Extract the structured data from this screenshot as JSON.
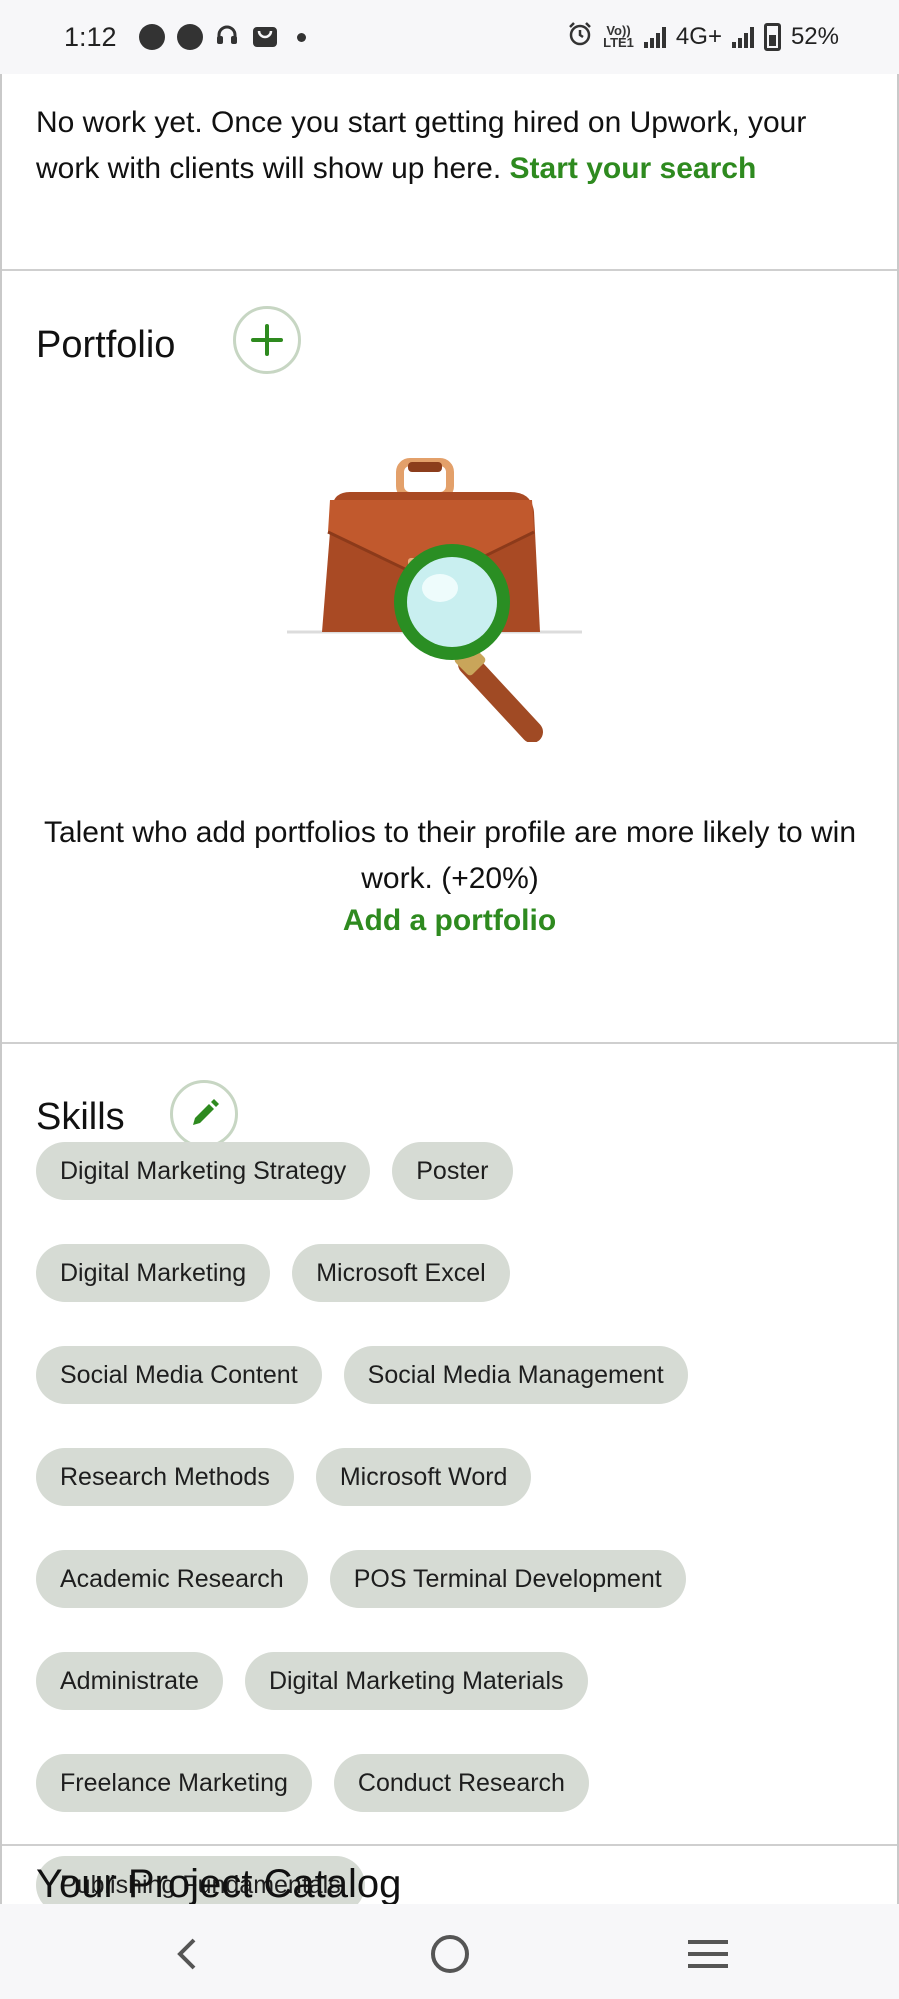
{
  "status_bar": {
    "time": "1:12",
    "left_icons": [
      "messenger-icon",
      "speedometer-icon",
      "headphones-icon",
      "shopping-bag-icon",
      "dot-icon"
    ],
    "volte_label_top": "Vo))",
    "volte_label_bottom": "LTE1",
    "network": "4G+",
    "battery": "52%"
  },
  "work": {
    "text": "No work yet. Once you start getting hired on Upwork, your work with clients will show up here. ",
    "link": "Start your search"
  },
  "portfolio": {
    "title": "Portfolio",
    "description": "Talent who add portfolios to their profile are more likely to win work. (+20%)",
    "add_link": "Add a portfolio"
  },
  "skills": {
    "title": "Skills",
    "rows": [
      [
        "Digital Marketing Strategy",
        "Poster"
      ],
      [
        "Digital Marketing",
        "Microsoft Excel"
      ],
      [
        "Social Media Content",
        "Social Media Management"
      ],
      [
        "Research Methods",
        "Microsoft Word"
      ],
      [
        "Academic Research",
        "POS Terminal Development"
      ],
      [
        "Administrate",
        "Digital Marketing Materials"
      ],
      [
        "Freelance Marketing",
        "Conduct Research"
      ],
      [
        "Publishing Fundamentals"
      ]
    ]
  },
  "next_section": {
    "title": "Your Project Catalog"
  },
  "colors": {
    "accent_green": "#2e8a1f",
    "chip_bg": "#d6dbd4"
  }
}
